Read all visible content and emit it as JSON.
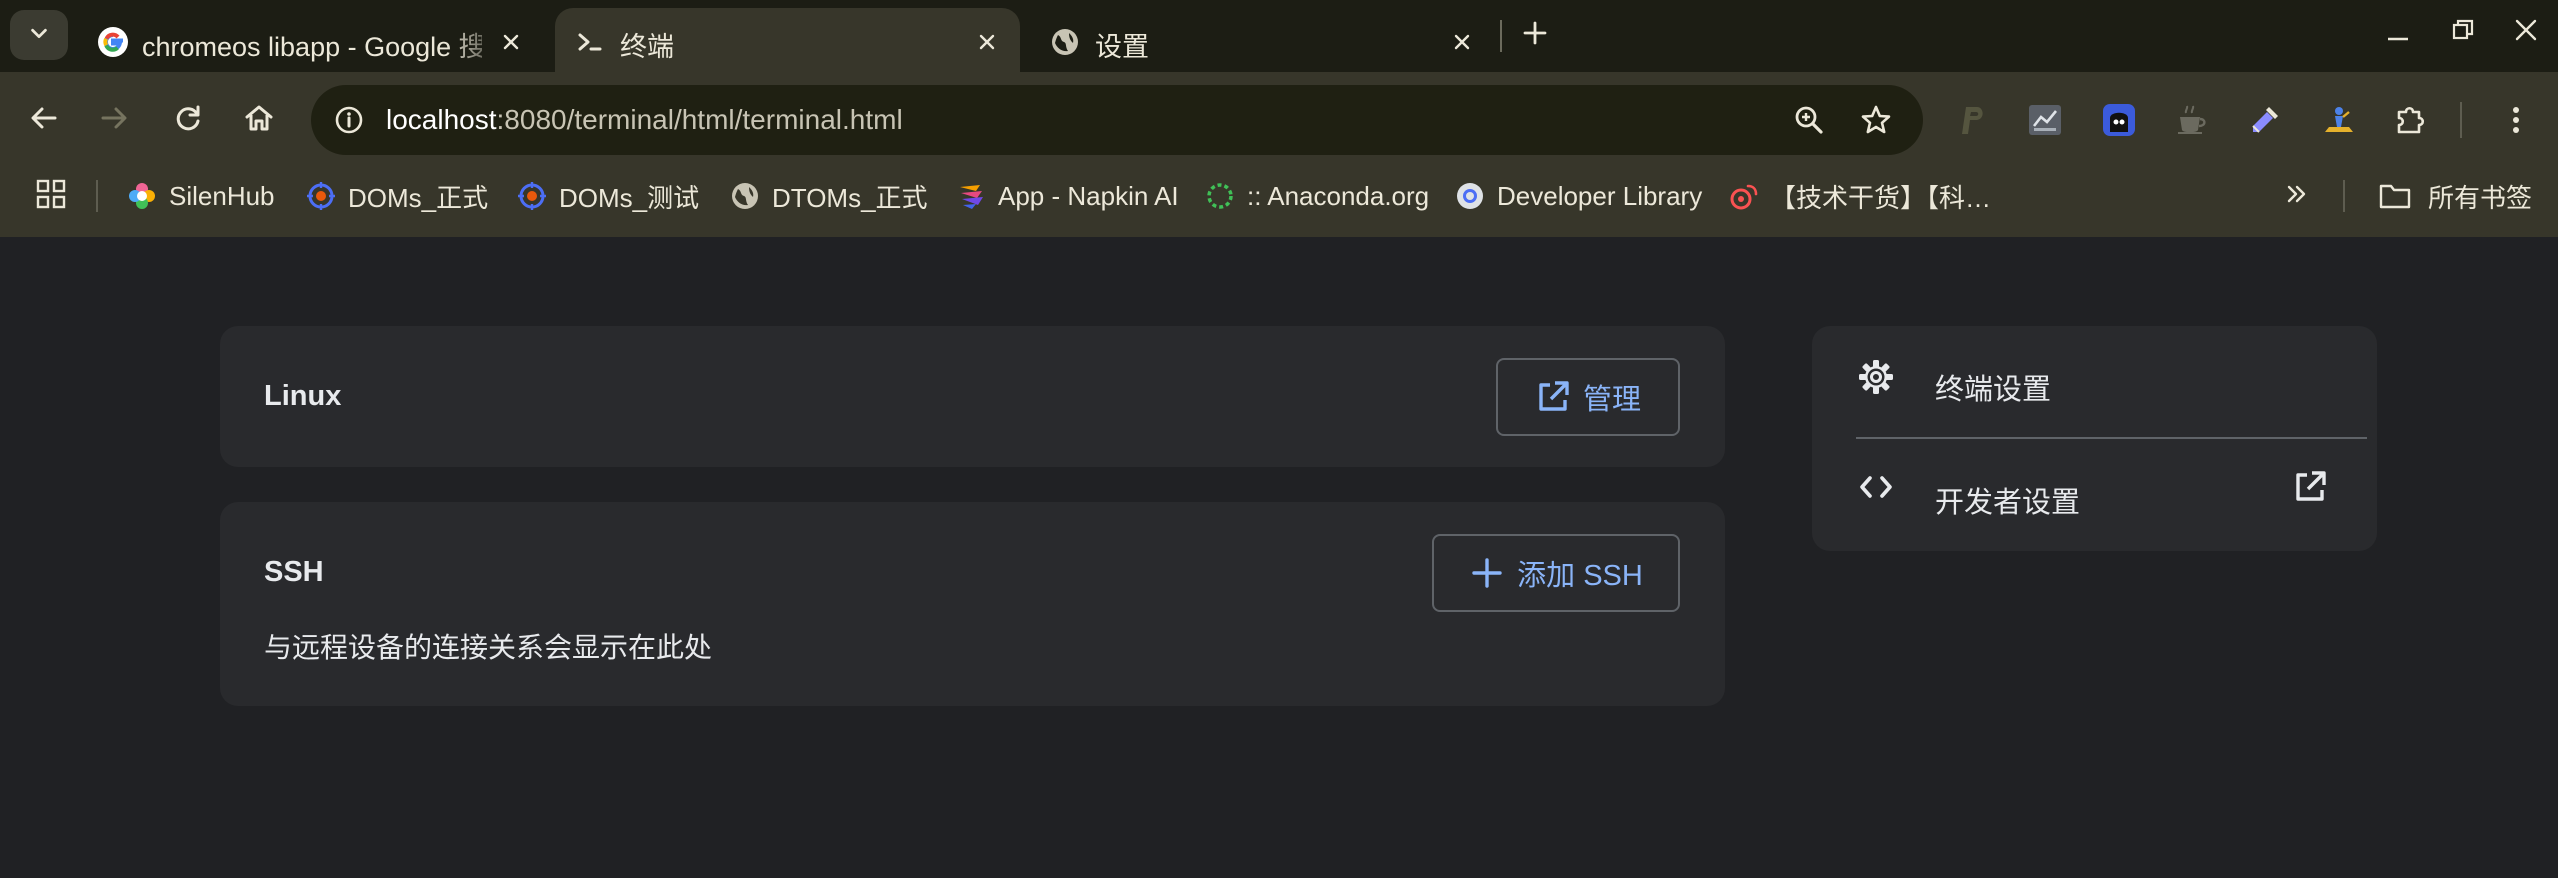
{
  "browser": {
    "tabs": [
      {
        "title": "chromeos libapp - Google 搜索",
        "icon": "google-g-icon",
        "active": false
      },
      {
        "title": "终端",
        "icon": "terminal-prompt-icon",
        "active": true
      },
      {
        "title": "设置",
        "icon": "globe-icon",
        "active": false
      }
    ],
    "new_tab_label": "+",
    "url_host": "localhost",
    "url_path": ":8080/terminal/html/terminal.html",
    "bookmarks": [
      {
        "label": "SilenHub",
        "icon": "silenhub-icon"
      },
      {
        "label": "DOMs_正式",
        "icon": "doms-target-icon"
      },
      {
        "label": "DOMs_测试",
        "icon": "doms-target-icon"
      },
      {
        "label": "DTOMs_正式",
        "icon": "globe-icon"
      },
      {
        "label": "App - Napkin AI",
        "icon": "napkin-icon"
      },
      {
        "label": ":: Anaconda.org",
        "icon": "anaconda-icon"
      },
      {
        "label": "Developer Library",
        "icon": "chrome-dev-icon"
      },
      {
        "label": "【技术干货】【科…",
        "icon": "weibo-icon"
      }
    ],
    "all_bookmarks_label": "所有书签",
    "extensions": [
      "p-extension-icon",
      "chart-extension-icon",
      "ghost-extension-icon",
      "coffee-extension-icon",
      "eyedropper-extension-icon",
      "traveler-extension-icon",
      "puzzle-extensions-icon"
    ]
  },
  "main": {
    "linux_card": {
      "title": "Linux",
      "manage_label": "管理"
    },
    "ssh_card": {
      "title": "SSH",
      "add_label": "添加 SSH",
      "description": "与远程设备的连接关系会显示在此处"
    },
    "settings_card": {
      "terminal_settings_label": "终端设置",
      "developer_settings_label": "开发者设置"
    }
  },
  "colors": {
    "page_bg": "#202124",
    "card_bg": "#292a2d",
    "accent": "#8ab4f8",
    "chrome_bg": "#37362a",
    "tabstrip_bg": "#1c1d14"
  }
}
